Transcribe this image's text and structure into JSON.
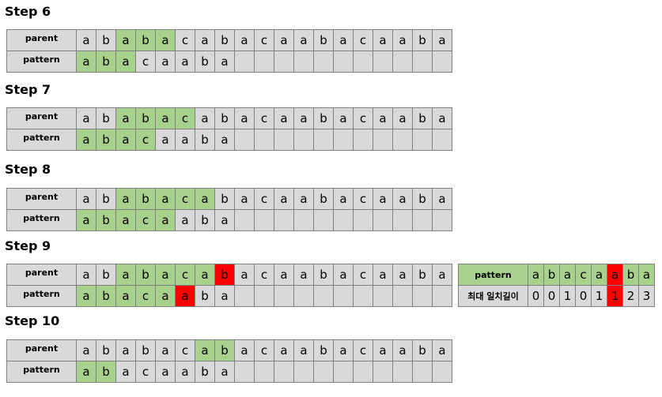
{
  "labels": {
    "parent": "parent",
    "pattern": "pattern",
    "max_match": "최대 일치길이"
  },
  "colors": {
    "match": "#a9d18e",
    "mismatch": "#ff0000",
    "cell": "#d9d9d9"
  },
  "steps": [
    {
      "title": "Step 6",
      "parent": [
        "a",
        "b",
        "a",
        "b",
        "a",
        "c",
        "a",
        "b",
        "a",
        "c",
        "a",
        "a",
        "b",
        "a",
        "c",
        "a",
        "a",
        "b",
        "a"
      ],
      "pattern": [
        "a",
        "b",
        "a",
        "c",
        "a",
        "a",
        "b",
        "a"
      ],
      "pattern_offset": 0,
      "parent_green": [
        2,
        3,
        4
      ],
      "parent_red": [],
      "pattern_green": [
        0,
        1,
        2
      ],
      "pattern_red": []
    },
    {
      "title": "Step 7",
      "parent": [
        "a",
        "b",
        "a",
        "b",
        "a",
        "c",
        "a",
        "b",
        "a",
        "c",
        "a",
        "a",
        "b",
        "a",
        "c",
        "a",
        "a",
        "b",
        "a"
      ],
      "pattern": [
        "a",
        "b",
        "a",
        "c",
        "a",
        "a",
        "b",
        "a"
      ],
      "pattern_offset": 0,
      "parent_green": [
        2,
        3,
        4,
        5
      ],
      "parent_red": [],
      "pattern_green": [
        0,
        1,
        2,
        3
      ],
      "pattern_red": []
    },
    {
      "title": "Step 8",
      "parent": [
        "a",
        "b",
        "a",
        "b",
        "a",
        "c",
        "a",
        "b",
        "a",
        "c",
        "a",
        "a",
        "b",
        "a",
        "c",
        "a",
        "a",
        "b",
        "a"
      ],
      "pattern": [
        "a",
        "b",
        "a",
        "c",
        "a",
        "a",
        "b",
        "a"
      ],
      "pattern_offset": 0,
      "parent_green": [
        2,
        3,
        4,
        5,
        6
      ],
      "parent_red": [],
      "pattern_green": [
        0,
        1,
        2,
        3,
        4
      ],
      "pattern_red": []
    },
    {
      "title": "Step 9",
      "parent": [
        "a",
        "b",
        "a",
        "b",
        "a",
        "c",
        "a",
        "b",
        "a",
        "c",
        "a",
        "a",
        "b",
        "a",
        "c",
        "a",
        "a",
        "b",
        "a"
      ],
      "pattern": [
        "a",
        "b",
        "a",
        "c",
        "a",
        "a",
        "b",
        "a"
      ],
      "pattern_offset": 0,
      "parent_green": [
        2,
        3,
        4,
        5,
        6
      ],
      "parent_red": [
        7
      ],
      "pattern_green": [
        0,
        1,
        2,
        3,
        4
      ],
      "pattern_red": [
        5
      ]
    },
    {
      "title": "Step 10",
      "parent": [
        "a",
        "b",
        "a",
        "b",
        "a",
        "c",
        "a",
        "b",
        "a",
        "c",
        "a",
        "a",
        "b",
        "a",
        "c",
        "a",
        "a",
        "b",
        "a"
      ],
      "pattern": [
        "a",
        "b",
        "a",
        "c",
        "a",
        "a",
        "b",
        "a"
      ],
      "pattern_offset": 0,
      "parent_green": [
        6,
        7
      ],
      "parent_red": [],
      "pattern_green": [
        0,
        1
      ],
      "pattern_red": []
    }
  ],
  "failure_table": {
    "pattern": [
      "a",
      "b",
      "a",
      "c",
      "a",
      "a",
      "b",
      "a"
    ],
    "values": [
      "0",
      "0",
      "1",
      "0",
      "1",
      "1",
      "2",
      "3"
    ],
    "red_index": 5
  }
}
